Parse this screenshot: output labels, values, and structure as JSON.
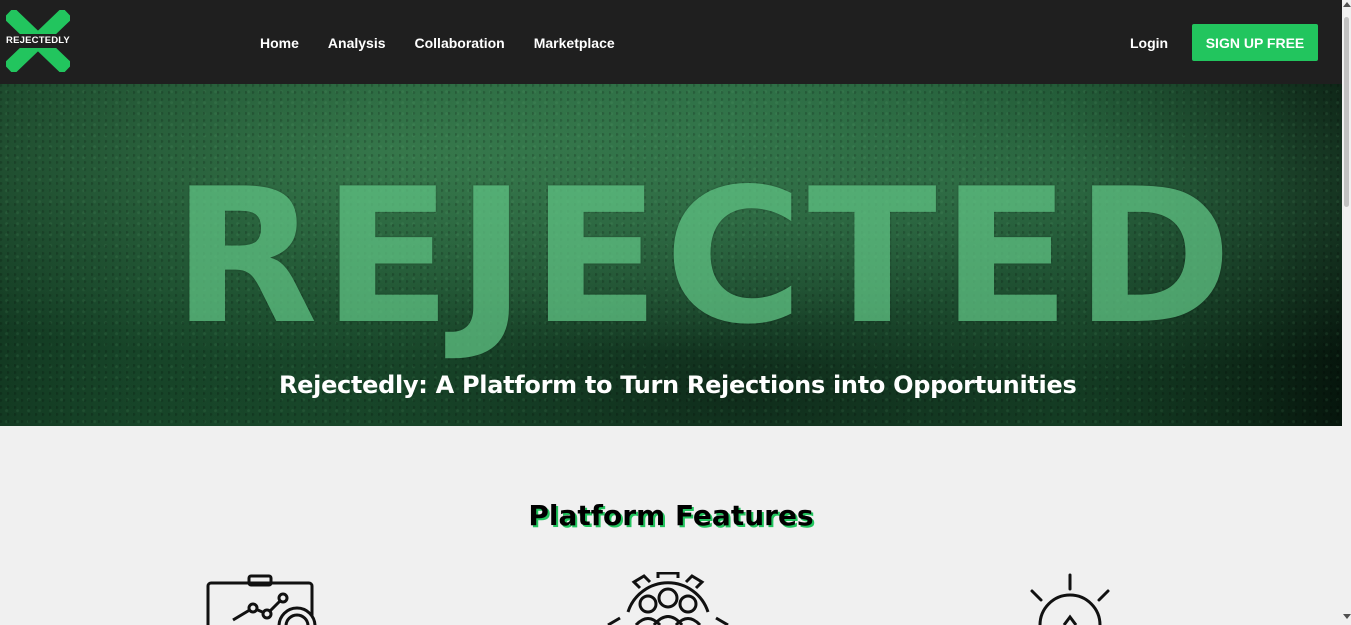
{
  "brand": {
    "logo_text": "REJECTEDLY",
    "accent_color": "#22c55e",
    "nav_bg": "#1f1f1f"
  },
  "nav": {
    "links": [
      "Home",
      "Analysis",
      "Collaboration",
      "Marketplace"
    ],
    "login_label": "Login",
    "signup_label": "SIGN UP FREE"
  },
  "hero": {
    "image_word": "REJECTED",
    "caption": "Rejectedly: A Platform to Turn Rejections into Opportunities"
  },
  "features": {
    "title": "Platform Features",
    "icons": [
      "analytics-board-icon",
      "team-gear-icon",
      "lightbulb-icon"
    ]
  }
}
